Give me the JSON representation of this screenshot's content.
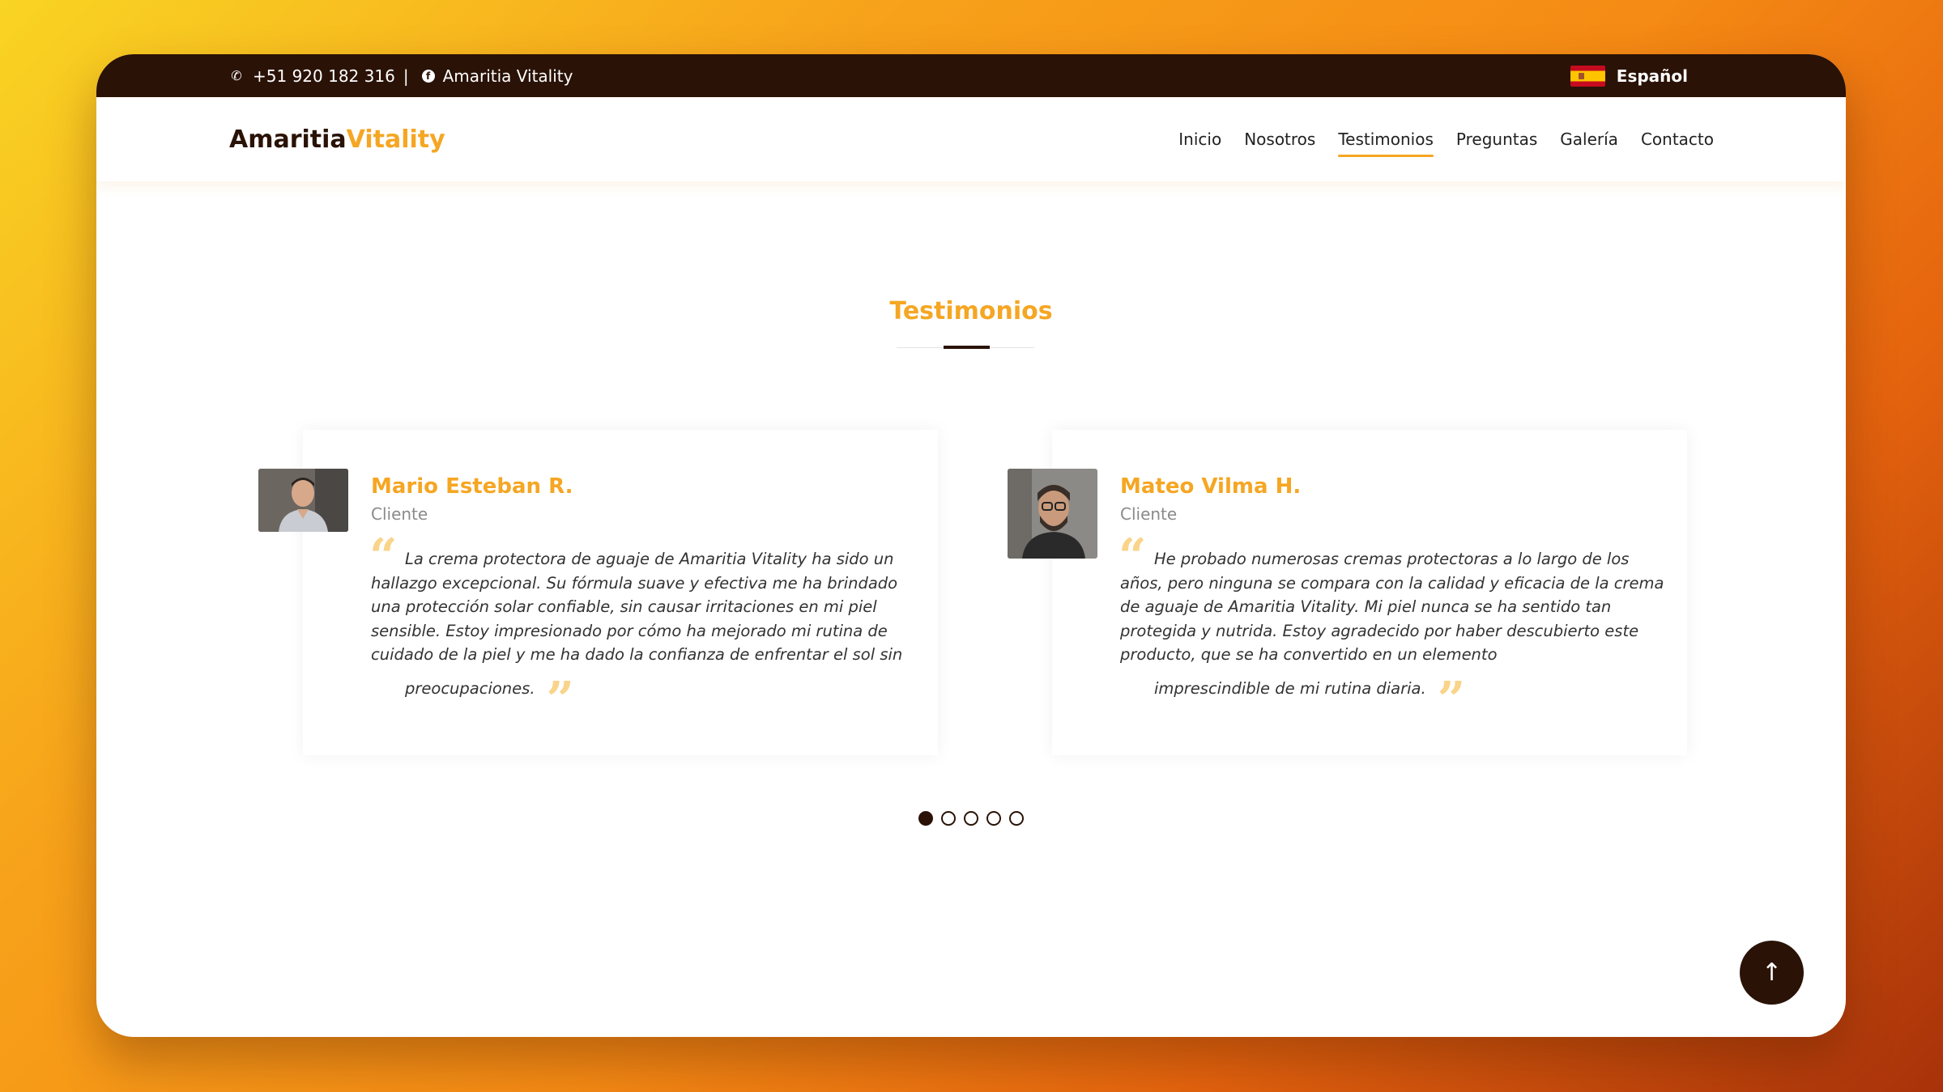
{
  "topbar": {
    "phone": "+51 920 182 316",
    "separator": "|",
    "social": "Amaritia Vitality",
    "language": "Español"
  },
  "header": {
    "logo_part1": "Amaritia",
    "logo_part2": "Vitality",
    "nav": [
      {
        "label": "Inicio"
      },
      {
        "label": "Nosotros"
      },
      {
        "label": "Testimonios",
        "active": true
      },
      {
        "label": "Preguntas"
      },
      {
        "label": "Galería"
      },
      {
        "label": "Contacto"
      }
    ]
  },
  "section": {
    "title": "Testimonios"
  },
  "testimonials": [
    {
      "name": "Mario Esteban R.",
      "role": "Cliente",
      "text_main": "La crema protectora de aguaje de Amaritia Vitality ha sido un hallazgo excepcional. Su fórmula suave y efectiva me ha brindado una protección solar confiable, sin causar irritaciones en mi piel sensible. Estoy impresionado por cómo ha mejorado mi rutina de cuidado de la piel y me ha dado la confianza de enfrentar el sol sin",
      "text_last": "preocupaciones."
    },
    {
      "name": "Mateo Vilma H.",
      "role": "Cliente",
      "text_main": "He probado numerosas cremas protectoras a lo largo de los años, pero ninguna se compara con la calidad y eficacia de la crema de aguaje de Amaritia Vitality. Mi piel nunca se ha sentido tan protegida y nutrida. Estoy agradecido por haber descubierto este producto, que se ha convertido en un elemento",
      "text_last": "imprescindible de mi rutina diaria."
    }
  ],
  "carousel": {
    "active_index": 1,
    "total": 5
  },
  "colors": {
    "accent": "#f5a623",
    "dark": "#2a1206"
  }
}
